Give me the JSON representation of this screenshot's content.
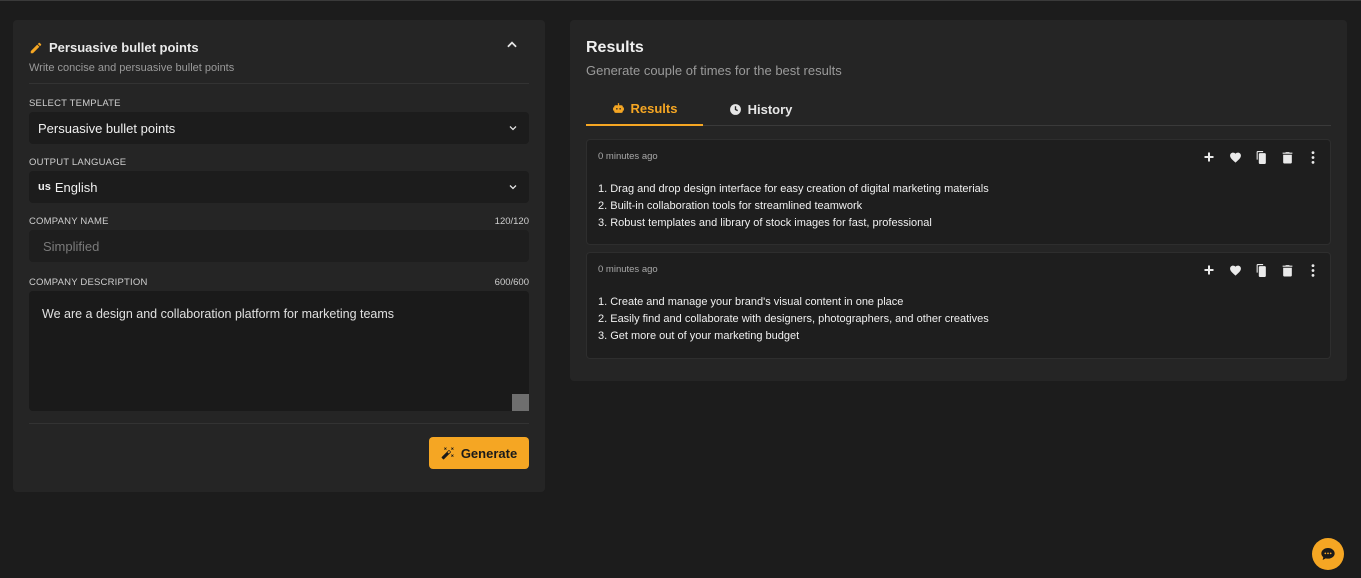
{
  "left_panel": {
    "title": "Persuasive bullet points",
    "subtitle": "Write concise and persuasive bullet points",
    "template_label": "SELECT TEMPLATE",
    "template_value": "Persuasive bullet points",
    "language_label": "OUTPUT LANGUAGE",
    "language_flag": "us",
    "language_value": "English",
    "company_name_label": "COMPANY NAME",
    "company_name_counter": "120/120",
    "company_name_placeholder": "Simplified",
    "company_desc_label": "COMPANY DESCRIPTION",
    "company_desc_counter": "600/600",
    "company_desc_value": "We are a design and collaboration platform for marketing teams",
    "generate_label": "Generate"
  },
  "right_panel": {
    "title": "Results",
    "subtitle": "Generate couple of times for the best results",
    "tabs": [
      {
        "label": "Results",
        "icon": "robot-icon",
        "active": true
      },
      {
        "label": "History",
        "icon": "clock-icon",
        "active": false
      }
    ],
    "results": [
      {
        "time": "0 minutes ago",
        "items": [
          "1. Drag and drop design interface for easy creation of digital marketing materials",
          "2. Built-in collaboration tools for streamlined teamwork",
          "3. Robust templates and library of stock images for fast, professional"
        ]
      },
      {
        "time": "0 minutes ago",
        "items": [
          "1. Create and manage your brand's visual content in one place",
          "2. Easily find and collaborate with designers, photographers, and other creatives",
          "3. Get more out of your marketing budget"
        ]
      }
    ]
  },
  "colors": {
    "accent": "#f5a623",
    "background": "#1c1c1c",
    "panel": "#252525"
  }
}
